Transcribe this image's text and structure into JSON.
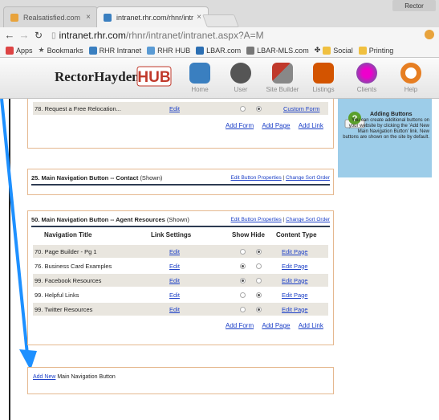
{
  "browser": {
    "profile": "Rector",
    "tabs": [
      {
        "title": "Realsatisfied.com",
        "active": false
      },
      {
        "title": "intranet.rhr.com/rhnr/intr",
        "active": true
      }
    ],
    "url_host": "intranet.rhr.com",
    "url_path": "/rhnr/intranet/intranet.aspx?A=M",
    "bookmarks": [
      "Apps",
      "Bookmarks",
      "RHR Intranet",
      "RHR HUB",
      "LBAR.com",
      "LBAR-MLS.com",
      "Social",
      "Printing"
    ]
  },
  "site": {
    "logo_text": "RectorHayden",
    "logo_hub": "HUB",
    "nav": [
      {
        "label": "Home",
        "icon": "house-icon",
        "color": "#3a7fc0"
      },
      {
        "label": "User",
        "icon": "user-icon",
        "color": "#555555"
      },
      {
        "label": "Site Builder",
        "icon": "tools-icon",
        "color": "#c0392b"
      },
      {
        "label": "Listings",
        "icon": "building-icon",
        "color": "#d35400"
      },
      {
        "label": "Clients",
        "icon": "people-icon",
        "color": "#8e44ad"
      },
      {
        "label": "Help",
        "icon": "lifebuoy-icon",
        "color": "#e67e22"
      }
    ]
  },
  "panel1": {
    "row": {
      "title": "78. Request a Free Relocation...",
      "edit": "Edit",
      "content": "Custom Form"
    },
    "links": [
      "Add Form",
      "Add Page",
      "Add Link"
    ]
  },
  "panel2": {
    "title": "25. Main Navigation Button -- Contact",
    "status": "(Shown)",
    "link_edit": "Edit Button Properties",
    "sep": "|",
    "link_sort": "Change Sort Order"
  },
  "panel3": {
    "title": "50. Main Navigation Button -- Agent Resources",
    "status": "(Shown)",
    "link_edit": "Edit Button Properties",
    "sep": "|",
    "link_sort": "Change Sort Order",
    "headers": {
      "nav": "Navigation Title",
      "link": "Link Settings",
      "show": "Show Hide",
      "content": "Content Type"
    },
    "rows": [
      {
        "title": "70. Page Builder - Pg 1",
        "edit": "Edit",
        "content": "Edit Page"
      },
      {
        "title": "76. Business Card Examples",
        "edit": "Edit",
        "content": "Edit Page"
      },
      {
        "title": "99. Facebook Resources",
        "edit": "Edit",
        "content": "Edit Page"
      },
      {
        "title": "99. Helpful Links",
        "edit": "Edit",
        "content": "Edit Page"
      },
      {
        "title": "99. Twitter Resources",
        "edit": "Edit",
        "content": "Edit Page"
      }
    ],
    "links": [
      "Add Form",
      "Add Page",
      "Add Link"
    ]
  },
  "panel4": {
    "link": "Add New",
    "text": " Main Navigation Button"
  },
  "help": {
    "title": "Adding Buttons",
    "text": "You can create additional buttons on your website by clicking the 'Add New Main Navigation Button' link. New buttons are shown on the site by default."
  },
  "colors": {
    "link": "#1b3fc7",
    "panel_border": "#e5b88f",
    "help_bg": "#9dcde9",
    "arrow": "#1e90ff"
  }
}
